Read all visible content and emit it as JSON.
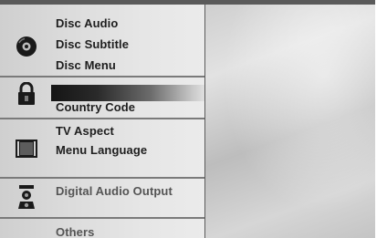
{
  "menu": {
    "disc_group": {
      "icon": "disc-icon",
      "items": [
        "Disc Audio",
        "Disc Subtitle",
        "Disc Menu"
      ]
    },
    "lock_group": {
      "icon": "lock-icon",
      "items": [
        "",
        "Country Code"
      ]
    },
    "display_group": {
      "icon": "tv-screen-icon",
      "items": [
        "TV Aspect",
        "Menu Language"
      ]
    },
    "audio_group": {
      "icon": "speaker-icon",
      "items": [
        "Digital Audio Output"
      ]
    },
    "others_group": {
      "items": [
        "Others"
      ]
    }
  },
  "colors": {
    "highlight": "#151515",
    "text": "#1e1e1e",
    "background": "#dcdcdc"
  }
}
